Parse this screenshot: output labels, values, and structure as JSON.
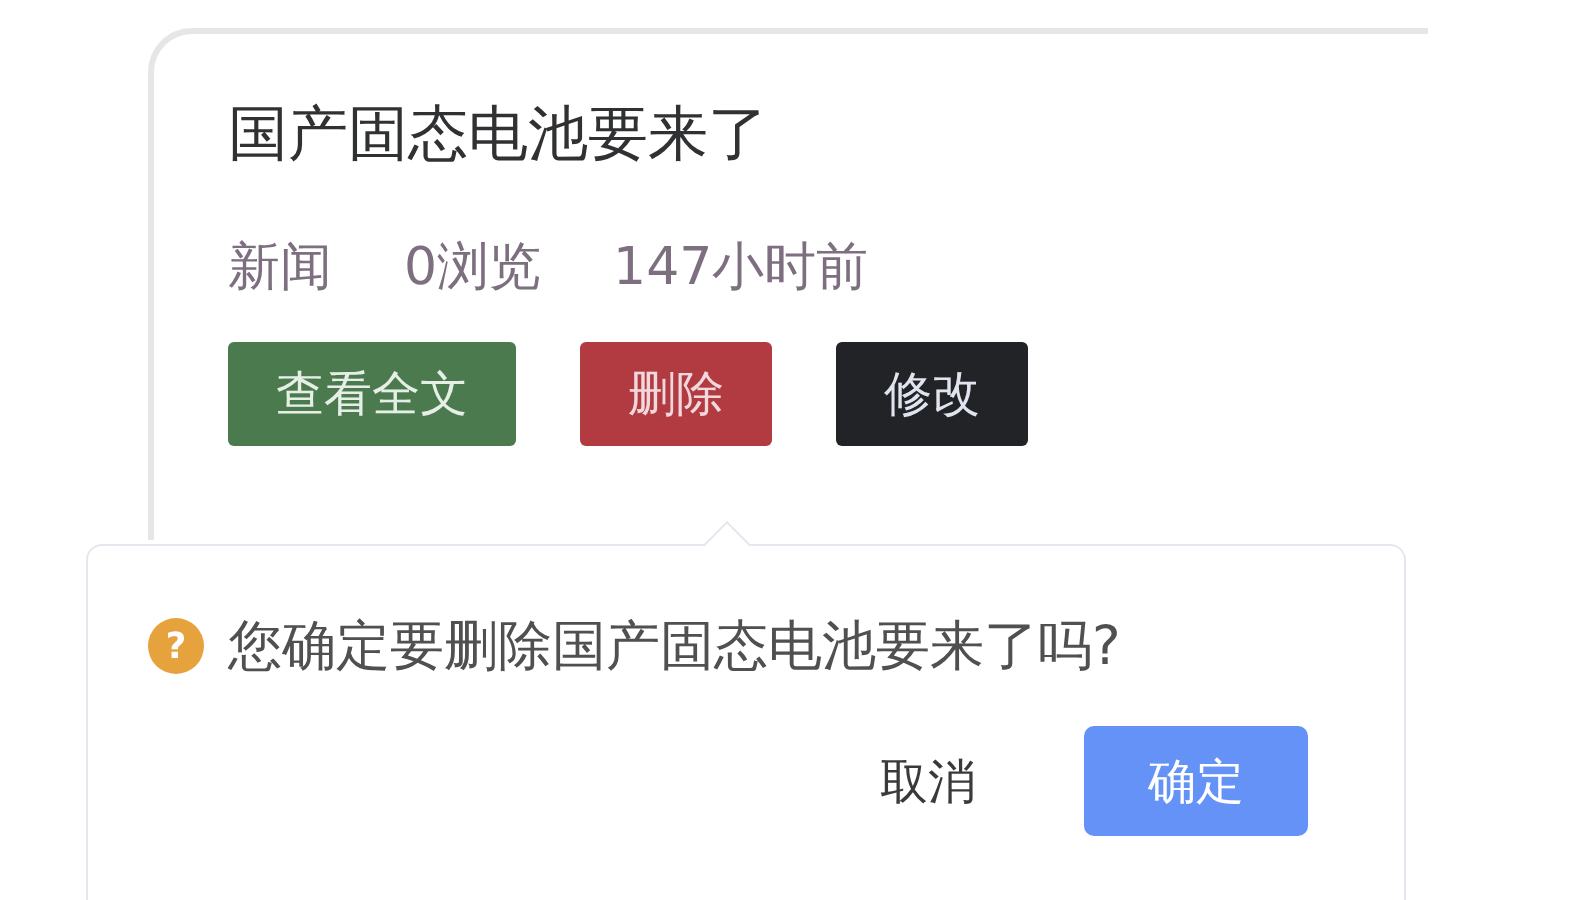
{
  "article": {
    "title": "国产固态电池要来了",
    "meta": [
      "新闻",
      "0浏览",
      "147小时前"
    ],
    "buttons": [
      {
        "label": "查看全文",
        "kind": "success"
      },
      {
        "label": "删除",
        "kind": "danger"
      },
      {
        "label": "修改",
        "kind": "dark"
      }
    ]
  },
  "popconfirm": {
    "icon": "?",
    "message": "您确定要删除国产固态电池要来了吗?",
    "buttons": [
      {
        "label": "取消",
        "kind": "text"
      },
      {
        "label": "确定",
        "kind": "primary"
      }
    ]
  }
}
